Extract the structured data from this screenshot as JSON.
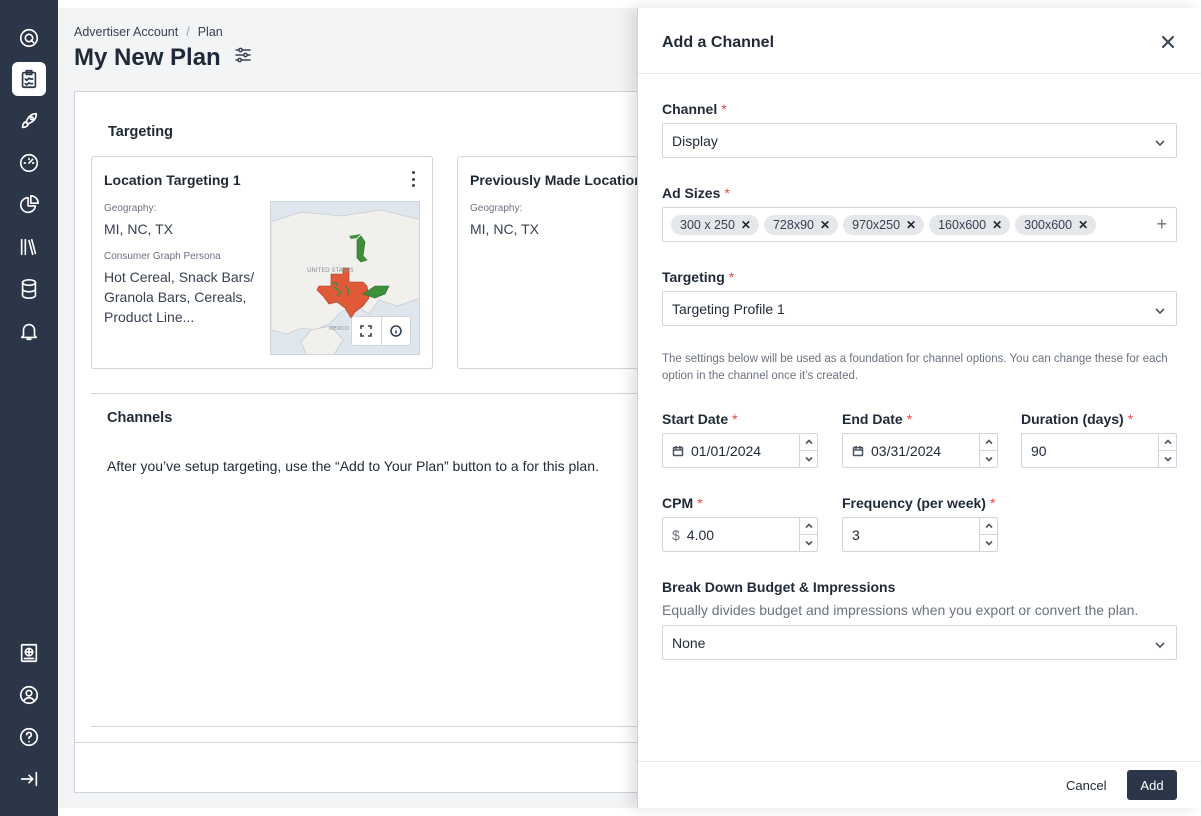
{
  "sidebar": {
    "top_items": [
      {
        "icon": "brand-logo-icon"
      },
      {
        "icon": "plans-clipboard-icon",
        "active": true
      },
      {
        "icon": "rocket-icon"
      },
      {
        "icon": "gauge-icon"
      },
      {
        "icon": "pie-chart-icon"
      },
      {
        "icon": "library-icon"
      },
      {
        "icon": "database-icon"
      },
      {
        "icon": "bell-icon"
      }
    ],
    "bottom_items": [
      {
        "icon": "globe-book-icon"
      },
      {
        "icon": "user-circle-icon"
      },
      {
        "icon": "help-circle-icon"
      },
      {
        "icon": "collapse-arrow-icon"
      }
    ]
  },
  "breadcrumb": {
    "items": [
      "Advertiser Account",
      "Plan"
    ],
    "separator": "/"
  },
  "page": {
    "title": "My New Plan"
  },
  "targeting": {
    "section_title": "Targeting",
    "cards": [
      {
        "title": "Location Targeting 1",
        "geography_label": "Geography:",
        "geography_value": "MI, NC, TX",
        "persona_label": "Consumer Graph Persona",
        "persona_value": "Hot Cereal, Snack Bars/ Granola Bars, Cereals, Product Line..."
      },
      {
        "title": "Previously Made Location",
        "geography_label": "Geography:",
        "geography_value": "MI, NC, TX"
      }
    ]
  },
  "channels": {
    "section_title": "Channels",
    "empty_text": "After you’ve setup targeting, use the “Add to Your Plan” button to a for this plan."
  },
  "drawer": {
    "title": "Add a Channel",
    "channel": {
      "label": "Channel",
      "value": "Display"
    },
    "ad_sizes": {
      "label": "Ad Sizes",
      "tags": [
        "300 x 250",
        "728x90",
        "970x250",
        "160x600",
        "300x600"
      ],
      "add_symbol": "+"
    },
    "targeting": {
      "label": "Targeting",
      "value": "Targeting Profile 1"
    },
    "help_text": "The settings below will be used as a foundation for channel options. You can change these for each option in the channel once it’s created.",
    "start_date": {
      "label": "Start Date",
      "value": "01/01/2024"
    },
    "end_date": {
      "label": "End Date",
      "value": "03/31/2024"
    },
    "duration": {
      "label": "Duration (days)",
      "value": "90"
    },
    "cpm": {
      "label": "CPM",
      "prefix": "$",
      "value": "4.00"
    },
    "frequency": {
      "label": "Frequency (per week)",
      "value": "3"
    },
    "breakdown": {
      "label": "Break Down Budget & Impressions",
      "help": "Equally divides budget and impressions when you export or convert the plan.",
      "value": "None"
    },
    "required_mark": "*",
    "cancel_label": "Cancel",
    "add_label": "Add"
  },
  "colors": {
    "sidebar_bg": "#2b3648",
    "primary_button": "#2b3648",
    "required": "#ef4444",
    "map_texas": "#e05a3a",
    "map_green": "#3f8f3a"
  }
}
